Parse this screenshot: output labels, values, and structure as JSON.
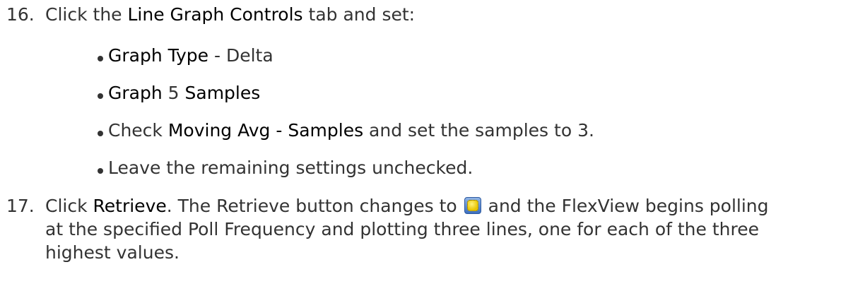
{
  "step16": {
    "number": "16.",
    "pre": "Click the ",
    "tab_name": "Line Graph Controls",
    "post": " tab and set:"
  },
  "bullets": {
    "graph_type": {
      "label": "Graph Type",
      "sep": " - ",
      "value": "Delta"
    },
    "graph_samples": {
      "pre": "Graph",
      "value": " 5 ",
      "post": "Samples"
    },
    "moving_avg": {
      "pre": "Check ",
      "label": "Moving Avg - Samples",
      "post": " and set the samples to 3."
    },
    "remaining": {
      "text": "Leave the remaining settings unchecked."
    }
  },
  "step17": {
    "number": "17.",
    "pre": "Click ",
    "button_name": "Retrieve",
    "mid": ". The Retrieve button changes to ",
    "icon": "stop-polling-icon",
    "line1_post": " and the FlexView begins polling",
    "line2": "at the specified Poll Frequency and plotting three lines, one for each of the three",
    "line3": "highest values."
  }
}
